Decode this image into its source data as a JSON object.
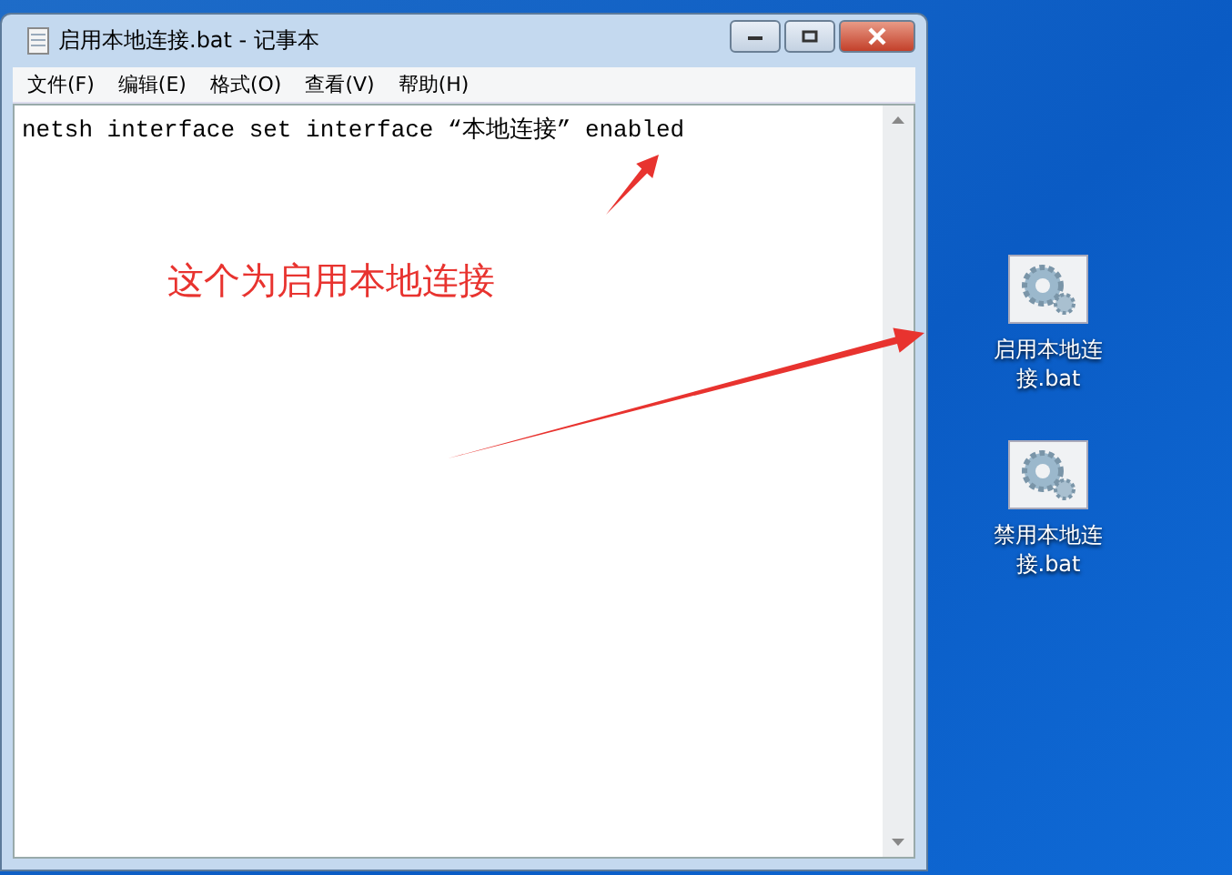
{
  "window": {
    "title": "启用本地连接.bat - 记事本"
  },
  "menu": [
    {
      "label": "文件(F)"
    },
    {
      "label": "编辑(E)"
    },
    {
      "label": "格式(O)"
    },
    {
      "label": "查看(V)"
    },
    {
      "label": "帮助(H)"
    }
  ],
  "editor": {
    "text": "netsh interface set interface “本地连接” enabled"
  },
  "annotation": {
    "text": "这个为启用本地连接"
  },
  "desktop_icons": [
    {
      "label": "启用本地连接.bat"
    },
    {
      "label": "禁用本地连接.bat"
    }
  ]
}
